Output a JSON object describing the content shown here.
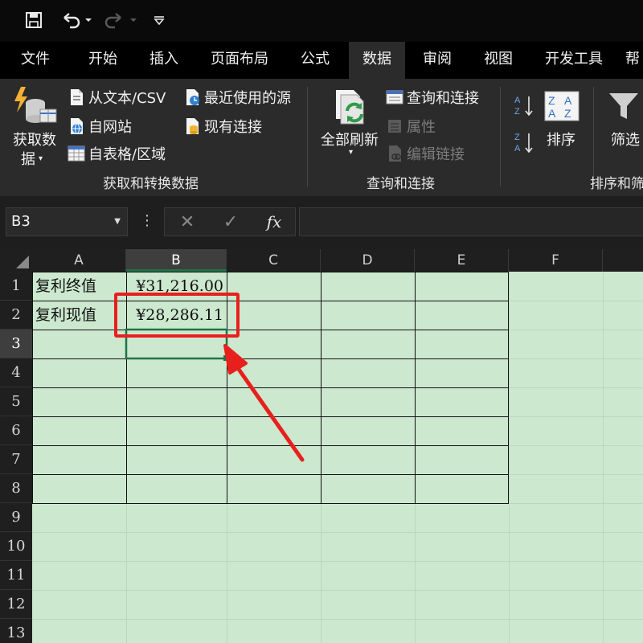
{
  "quick_access": {
    "icons": [
      "save-icon",
      "undo-icon",
      "redo-icon",
      "customize-icon"
    ]
  },
  "tabs": [
    {
      "label": "文件",
      "active": false
    },
    {
      "label": "开始",
      "active": false
    },
    {
      "label": "插入",
      "active": false
    },
    {
      "label": "页面布局",
      "active": false
    },
    {
      "label": "公式",
      "active": false
    },
    {
      "label": "数据",
      "active": true
    },
    {
      "label": "审阅",
      "active": false
    },
    {
      "label": "视图",
      "active": false
    },
    {
      "label": "开发工具",
      "active": false
    },
    {
      "label": "帮",
      "active": false
    }
  ],
  "ribbon": {
    "get_transform": {
      "get_data_line1": "获取数",
      "get_data_line2": "据",
      "from_text_csv": "从文本/CSV",
      "from_web": "自网站",
      "from_table": "自表格/区域",
      "recent_sources": "最近使用的源",
      "existing_connections": "现有连接",
      "group_label": "获取和转换数据"
    },
    "queries": {
      "refresh_all": "全部刷新",
      "queries_connections": "查询和连接",
      "properties": "属性",
      "edit_links": "编辑链接",
      "group_label": "查询和连接"
    },
    "sort_filter": {
      "sort": "排序",
      "filter": "筛选",
      "group_label": "排序和筛"
    }
  },
  "formula_bar": {
    "name_box": "B3",
    "dots": "⋮",
    "cancel": "✕",
    "enter": "✓",
    "fx": "fx",
    "formula": ""
  },
  "sheet": {
    "columns": [
      "A",
      "B",
      "C",
      "D",
      "E",
      "F"
    ],
    "rows": [
      "1",
      "2",
      "3",
      "4",
      "5",
      "6",
      "7",
      "8",
      "9",
      "10",
      "11",
      "12",
      "13"
    ],
    "selected_cell": "B3",
    "cells": {
      "A1": "复利终值",
      "B1": "¥31,216.00",
      "A2": "复利现值",
      "B2": "¥28,286.11"
    }
  },
  "colors": {
    "accent_green": "#217346",
    "sheet_bg": "#cce8cf",
    "annotation_red": "#e8201d"
  }
}
